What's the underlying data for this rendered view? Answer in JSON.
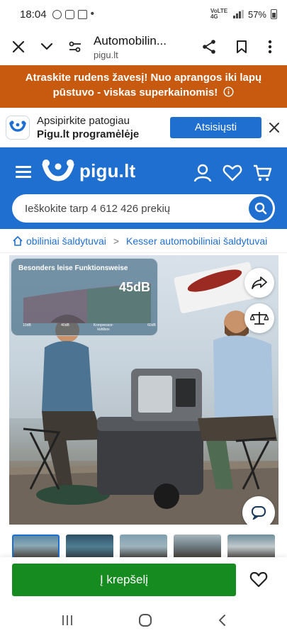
{
  "status_bar": {
    "time": "18:04",
    "network": "VoLTE 4G",
    "battery": "57%"
  },
  "browser": {
    "page_title": "Automobilin...",
    "url": "pigu.lt"
  },
  "promo": {
    "text": "Atraskite rudens žavesį! Nuo aprangos iki lapų pūstuvo - viskas superkainomis!",
    "info_icon": "info-circle-icon"
  },
  "app_banner": {
    "line1": "Apsipirkite patogiau",
    "line2": "Pigu.lt programėlėje",
    "download_label": "Atsisiųsti"
  },
  "header": {
    "logo_text": "pigu.lt",
    "search_placeholder": "Ieškokite tarp 4 612 426 prekių"
  },
  "breadcrumb": {
    "items": [
      "obiliniai šaldytuvai",
      "Kesser automobiliniai šaldytuvai"
    ]
  },
  "product_image": {
    "overlay_title": "Besonders leise Funktionsweise",
    "overlay_db": "45dB",
    "overlay_labels": [
      "Kompressor-kühlbox",
      "10dB",
      "40dB",
      "60dB"
    ]
  },
  "action_bar": {
    "add_to_cart_label": "Į krepšelį"
  },
  "colors": {
    "brand_blue": "#1f6fd1",
    "promo_orange": "#c75a0e",
    "cart_green": "#168b1f"
  }
}
